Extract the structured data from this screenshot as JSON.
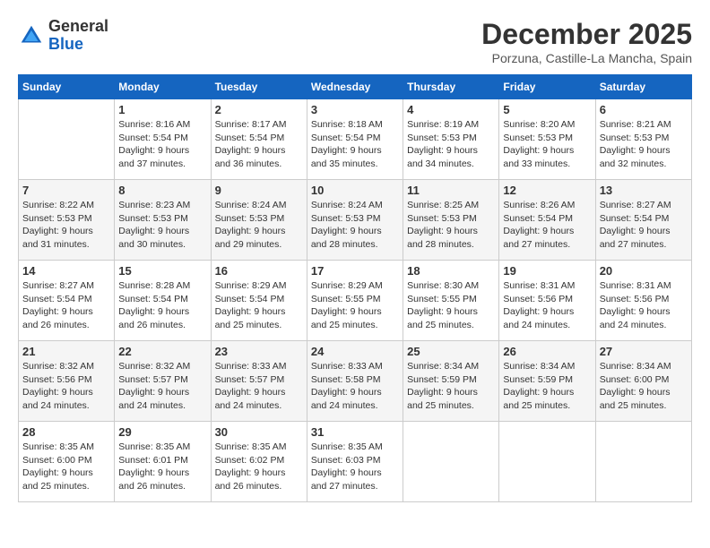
{
  "logo": {
    "general": "General",
    "blue": "Blue"
  },
  "title": "December 2025",
  "subtitle": "Porzuna, Castille-La Mancha, Spain",
  "days_header": [
    "Sunday",
    "Monday",
    "Tuesday",
    "Wednesday",
    "Thursday",
    "Friday",
    "Saturday"
  ],
  "weeks": [
    [
      {
        "day": "",
        "sunrise": "",
        "sunset": "",
        "daylight": ""
      },
      {
        "day": "1",
        "sunrise": "Sunrise: 8:16 AM",
        "sunset": "Sunset: 5:54 PM",
        "daylight": "Daylight: 9 hours and 37 minutes."
      },
      {
        "day": "2",
        "sunrise": "Sunrise: 8:17 AM",
        "sunset": "Sunset: 5:54 PM",
        "daylight": "Daylight: 9 hours and 36 minutes."
      },
      {
        "day": "3",
        "sunrise": "Sunrise: 8:18 AM",
        "sunset": "Sunset: 5:54 PM",
        "daylight": "Daylight: 9 hours and 35 minutes."
      },
      {
        "day": "4",
        "sunrise": "Sunrise: 8:19 AM",
        "sunset": "Sunset: 5:53 PM",
        "daylight": "Daylight: 9 hours and 34 minutes."
      },
      {
        "day": "5",
        "sunrise": "Sunrise: 8:20 AM",
        "sunset": "Sunset: 5:53 PM",
        "daylight": "Daylight: 9 hours and 33 minutes."
      },
      {
        "day": "6",
        "sunrise": "Sunrise: 8:21 AM",
        "sunset": "Sunset: 5:53 PM",
        "daylight": "Daylight: 9 hours and 32 minutes."
      }
    ],
    [
      {
        "day": "7",
        "sunrise": "Sunrise: 8:22 AM",
        "sunset": "Sunset: 5:53 PM",
        "daylight": "Daylight: 9 hours and 31 minutes."
      },
      {
        "day": "8",
        "sunrise": "Sunrise: 8:23 AM",
        "sunset": "Sunset: 5:53 PM",
        "daylight": "Daylight: 9 hours and 30 minutes."
      },
      {
        "day": "9",
        "sunrise": "Sunrise: 8:24 AM",
        "sunset": "Sunset: 5:53 PM",
        "daylight": "Daylight: 9 hours and 29 minutes."
      },
      {
        "day": "10",
        "sunrise": "Sunrise: 8:24 AM",
        "sunset": "Sunset: 5:53 PM",
        "daylight": "Daylight: 9 hours and 28 minutes."
      },
      {
        "day": "11",
        "sunrise": "Sunrise: 8:25 AM",
        "sunset": "Sunset: 5:53 PM",
        "daylight": "Daylight: 9 hours and 28 minutes."
      },
      {
        "day": "12",
        "sunrise": "Sunrise: 8:26 AM",
        "sunset": "Sunset: 5:54 PM",
        "daylight": "Daylight: 9 hours and 27 minutes."
      },
      {
        "day": "13",
        "sunrise": "Sunrise: 8:27 AM",
        "sunset": "Sunset: 5:54 PM",
        "daylight": "Daylight: 9 hours and 27 minutes."
      }
    ],
    [
      {
        "day": "14",
        "sunrise": "Sunrise: 8:27 AM",
        "sunset": "Sunset: 5:54 PM",
        "daylight": "Daylight: 9 hours and 26 minutes."
      },
      {
        "day": "15",
        "sunrise": "Sunrise: 8:28 AM",
        "sunset": "Sunset: 5:54 PM",
        "daylight": "Daylight: 9 hours and 26 minutes."
      },
      {
        "day": "16",
        "sunrise": "Sunrise: 8:29 AM",
        "sunset": "Sunset: 5:54 PM",
        "daylight": "Daylight: 9 hours and 25 minutes."
      },
      {
        "day": "17",
        "sunrise": "Sunrise: 8:29 AM",
        "sunset": "Sunset: 5:55 PM",
        "daylight": "Daylight: 9 hours and 25 minutes."
      },
      {
        "day": "18",
        "sunrise": "Sunrise: 8:30 AM",
        "sunset": "Sunset: 5:55 PM",
        "daylight": "Daylight: 9 hours and 25 minutes."
      },
      {
        "day": "19",
        "sunrise": "Sunrise: 8:31 AM",
        "sunset": "Sunset: 5:56 PM",
        "daylight": "Daylight: 9 hours and 24 minutes."
      },
      {
        "day": "20",
        "sunrise": "Sunrise: 8:31 AM",
        "sunset": "Sunset: 5:56 PM",
        "daylight": "Daylight: 9 hours and 24 minutes."
      }
    ],
    [
      {
        "day": "21",
        "sunrise": "Sunrise: 8:32 AM",
        "sunset": "Sunset: 5:56 PM",
        "daylight": "Daylight: 9 hours and 24 minutes."
      },
      {
        "day": "22",
        "sunrise": "Sunrise: 8:32 AM",
        "sunset": "Sunset: 5:57 PM",
        "daylight": "Daylight: 9 hours and 24 minutes."
      },
      {
        "day": "23",
        "sunrise": "Sunrise: 8:33 AM",
        "sunset": "Sunset: 5:57 PM",
        "daylight": "Daylight: 9 hours and 24 minutes."
      },
      {
        "day": "24",
        "sunrise": "Sunrise: 8:33 AM",
        "sunset": "Sunset: 5:58 PM",
        "daylight": "Daylight: 9 hours and 24 minutes."
      },
      {
        "day": "25",
        "sunrise": "Sunrise: 8:34 AM",
        "sunset": "Sunset: 5:59 PM",
        "daylight": "Daylight: 9 hours and 25 minutes."
      },
      {
        "day": "26",
        "sunrise": "Sunrise: 8:34 AM",
        "sunset": "Sunset: 5:59 PM",
        "daylight": "Daylight: 9 hours and 25 minutes."
      },
      {
        "day": "27",
        "sunrise": "Sunrise: 8:34 AM",
        "sunset": "Sunset: 6:00 PM",
        "daylight": "Daylight: 9 hours and 25 minutes."
      }
    ],
    [
      {
        "day": "28",
        "sunrise": "Sunrise: 8:35 AM",
        "sunset": "Sunset: 6:00 PM",
        "daylight": "Daylight: 9 hours and 25 minutes."
      },
      {
        "day": "29",
        "sunrise": "Sunrise: 8:35 AM",
        "sunset": "Sunset: 6:01 PM",
        "daylight": "Daylight: 9 hours and 26 minutes."
      },
      {
        "day": "30",
        "sunrise": "Sunrise: 8:35 AM",
        "sunset": "Sunset: 6:02 PM",
        "daylight": "Daylight: 9 hours and 26 minutes."
      },
      {
        "day": "31",
        "sunrise": "Sunrise: 8:35 AM",
        "sunset": "Sunset: 6:03 PM",
        "daylight": "Daylight: 9 hours and 27 minutes."
      },
      {
        "day": "",
        "sunrise": "",
        "sunset": "",
        "daylight": ""
      },
      {
        "day": "",
        "sunrise": "",
        "sunset": "",
        "daylight": ""
      },
      {
        "day": "",
        "sunrise": "",
        "sunset": "",
        "daylight": ""
      }
    ]
  ]
}
